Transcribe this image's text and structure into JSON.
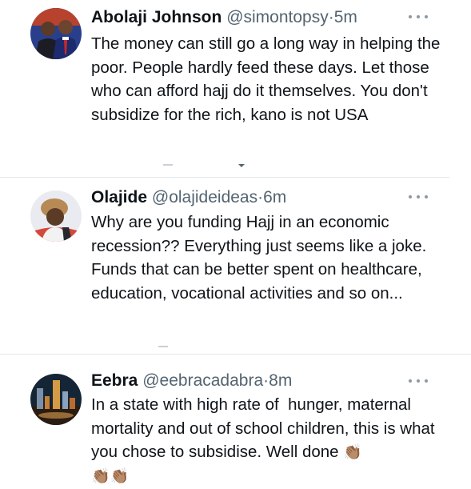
{
  "tweets": [
    {
      "name": "Abolaji Johnson",
      "handle": "@simontopsy",
      "dot": "·",
      "time": "5m",
      "text": "The money can still go a long way in helping the poor. People hardly feed these days. Let those who can afford hajj do it themselves. You don't subsidize for the rich, kano is not USA"
    },
    {
      "name": "Olajide",
      "handle": "@olajideideas",
      "dot": "·",
      "time": "6m",
      "text": "Why are you funding Hajj in an economic recession?? Everything just seems like a joke. Funds that can be better spent on healthcare, education, vocational activities and so on..."
    },
    {
      "name": "Eebra",
      "handle": "@eebracadabra",
      "dot": "·",
      "time": "8m",
      "text": "In a state with high rate of  hunger, maternal mortality and out of school children, this is what you chose to subsidise. Well done",
      "emoji": "👏🏽"
    }
  ],
  "icons": {
    "more": "more-icon",
    "clap": "clapping-hands-icon"
  },
  "colors": {
    "text": "#0f1419",
    "secondary": "#536471",
    "divider": "#e3e6e8"
  }
}
